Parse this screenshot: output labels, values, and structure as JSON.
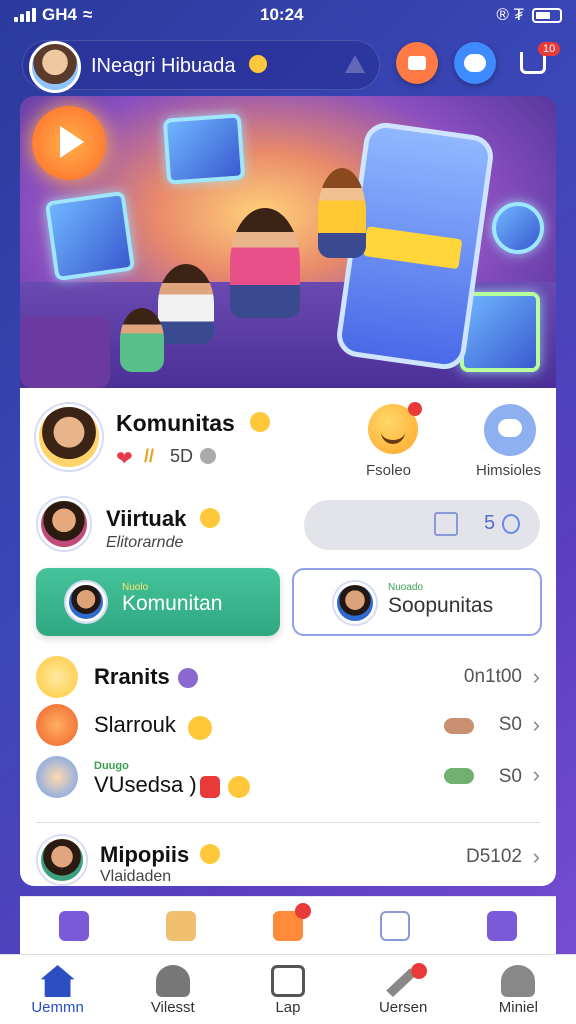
{
  "status_bar": {
    "carrier": "GH4",
    "time": "10:24",
    "right": "® ₮"
  },
  "header": {
    "title": "INeagri Hibuada",
    "cart_badge": "10"
  },
  "hero": {},
  "community": {
    "title": "Komunitas",
    "stats": "5D",
    "reaction_label": "Fsoleo",
    "messages_label": "Himsioles"
  },
  "virtual": {
    "title": "Viirtuak",
    "subtitle": "Elitorarnde",
    "pill_value": "5"
  },
  "buttons": {
    "primary_small": "Nuolo",
    "primary": "Komunitan",
    "secondary_small": "Nuoado",
    "secondary": "Soopunitas"
  },
  "list": [
    {
      "label": "Rranits",
      "value": "0n1t00"
    },
    {
      "label": "Slarrouk",
      "value": "S0"
    },
    {
      "small": "Duugo",
      "label": "VUsedsa )",
      "value": "S0"
    }
  ],
  "featured": {
    "title": "Mipopiis",
    "subtitle": "Vlaidaden",
    "value": "D5102"
  },
  "tabs": [
    {
      "label": "Uemmn",
      "icon": "home-icon"
    },
    {
      "label": "Vilesst",
      "icon": "user-group-icon"
    },
    {
      "label": "Lap",
      "icon": "document-icon"
    },
    {
      "label": "Uersen",
      "icon": "pen-icon"
    },
    {
      "label": "Miniel",
      "icon": "profile-icon"
    }
  ],
  "colors": {
    "accent": "#2fa882",
    "brand": "#3b47b8",
    "badge": "#e93a3a"
  }
}
